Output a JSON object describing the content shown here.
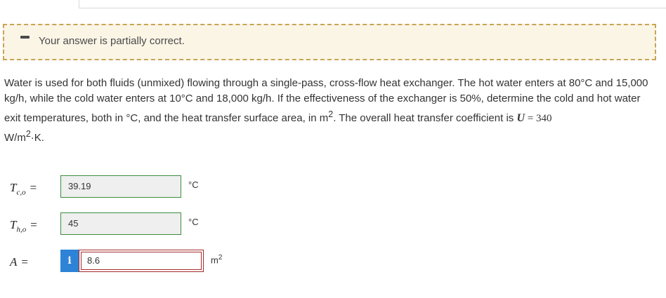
{
  "feedback": {
    "message": "Your answer is partially correct."
  },
  "question": {
    "text_part1": "Water is used for both fluids (unmixed) flowing through a single-pass, cross-flow heat exchanger. The hot water enters at 80°C and 15,000 kg/h, while the cold water enters at 10°C and 18,000 kg/h. If the effectiveness of the exchanger is 50%, determine the cold and hot water exit temperatures, both in °C, and the heat transfer surface area, in m",
    "sup_2a": "2",
    "text_part2": ". The overall heat transfer coefficient is ",
    "var_U": "U",
    "eq_text": " = 340",
    "text_part3": " W/m",
    "sup_2b": "2",
    "text_part4": "·K."
  },
  "answers": [
    {
      "symbol": "T",
      "subscript": "c,o",
      "eq": "=",
      "value": "39.19",
      "unit": "°C",
      "status": "correct"
    },
    {
      "symbol": "T",
      "subscript": "h,o",
      "eq": "=",
      "value": "45",
      "unit": "°C",
      "status": "correct"
    },
    {
      "symbol": "A",
      "subscript": "",
      "eq": "=",
      "value": "8.6",
      "unit_base": "m",
      "unit_sup": "2",
      "status": "incorrect",
      "info_icon": "i"
    }
  ],
  "colors": {
    "correct_border": "#3c8c3c",
    "incorrect_border": "#a52a2a",
    "feedback_bg": "#fbf5e6",
    "feedback_border": "#c9a456",
    "info_button": "#2e83d6"
  },
  "icons": {
    "feedback": "dash-icon",
    "info": "info-icon"
  }
}
